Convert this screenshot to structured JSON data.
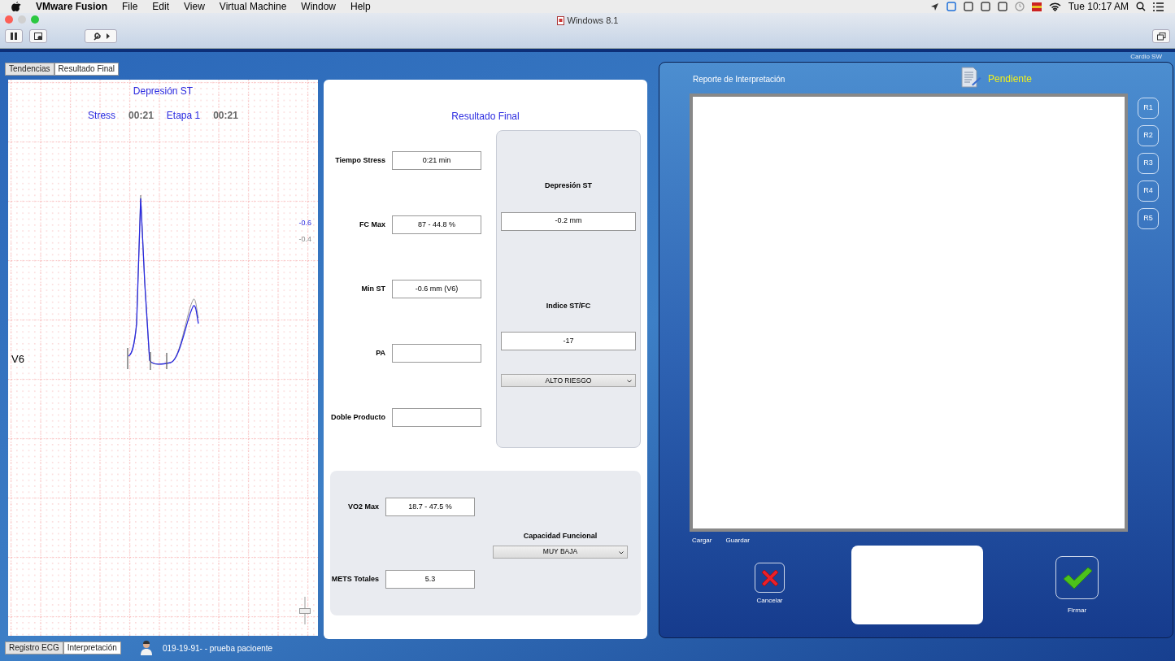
{
  "menu_bar": {
    "app": "VMware Fusion",
    "items": [
      "File",
      "Edit",
      "View",
      "Virtual Machine",
      "Window",
      "Help"
    ],
    "clock": "Tue 10:17 AM"
  },
  "window": {
    "title": "Windows 8.1",
    "corner_text": "Cardio SW"
  },
  "top_tabs": [
    {
      "label": "Tendencias",
      "selected": false
    },
    {
      "label": "Resultado Final",
      "selected": true
    }
  ],
  "ecg_panel": {
    "title": "Depresión ST",
    "timers": [
      {
        "label": "Stress",
        "time": "00:21"
      },
      {
        "label": "Etapa 1",
        "time": "00:21"
      }
    ],
    "lead": "V6",
    "readings": [
      {
        "text": "-0.6",
        "kind": "current"
      },
      {
        "text": "-0.4",
        "kind": "reference"
      }
    ],
    "zoom_slider": {
      "level": 0.5
    }
  },
  "bottom_tabs": [
    {
      "label": "Registro ECG",
      "selected": false
    },
    {
      "label": "Interpretación",
      "selected": true
    }
  ],
  "patient": "019-19-91- - prueba pacioente",
  "result": {
    "title": "Resultado Final",
    "fields": [
      {
        "label": "Tiempo Stress",
        "value": "0:21 min"
      },
      {
        "label": "FC Max",
        "value": "87 - 44.8 %"
      },
      {
        "label": "Min ST",
        "value": "-0.6 mm (V6)"
      },
      {
        "label": "PA"
      },
      {
        "label": "Doble Producto"
      }
    ],
    "st_box": {
      "depression_label": "Depresión ST",
      "depression_value": "-0.2 mm",
      "index_label": "Indice ST/FC",
      "index_value": "-17",
      "risk": "ALTO RIESGO"
    },
    "capacity": {
      "fields": [
        {
          "label": "VO2 Max",
          "value": "18.7 - 47.5 %"
        },
        {
          "label": "METS Totales",
          "value": "5.3"
        }
      ],
      "label": "Capacidad Funcional",
      "value": "MUY BAJA"
    }
  },
  "report": {
    "title": "Reporte de Interpretación",
    "status": "Pendiente",
    "side_buttons": [
      "R1",
      "R2",
      "R3",
      "R4",
      "R5"
    ],
    "links": [
      "Cargar",
      "Guardar"
    ],
    "cancel": "Cancelar",
    "sign": "Firmar"
  }
}
